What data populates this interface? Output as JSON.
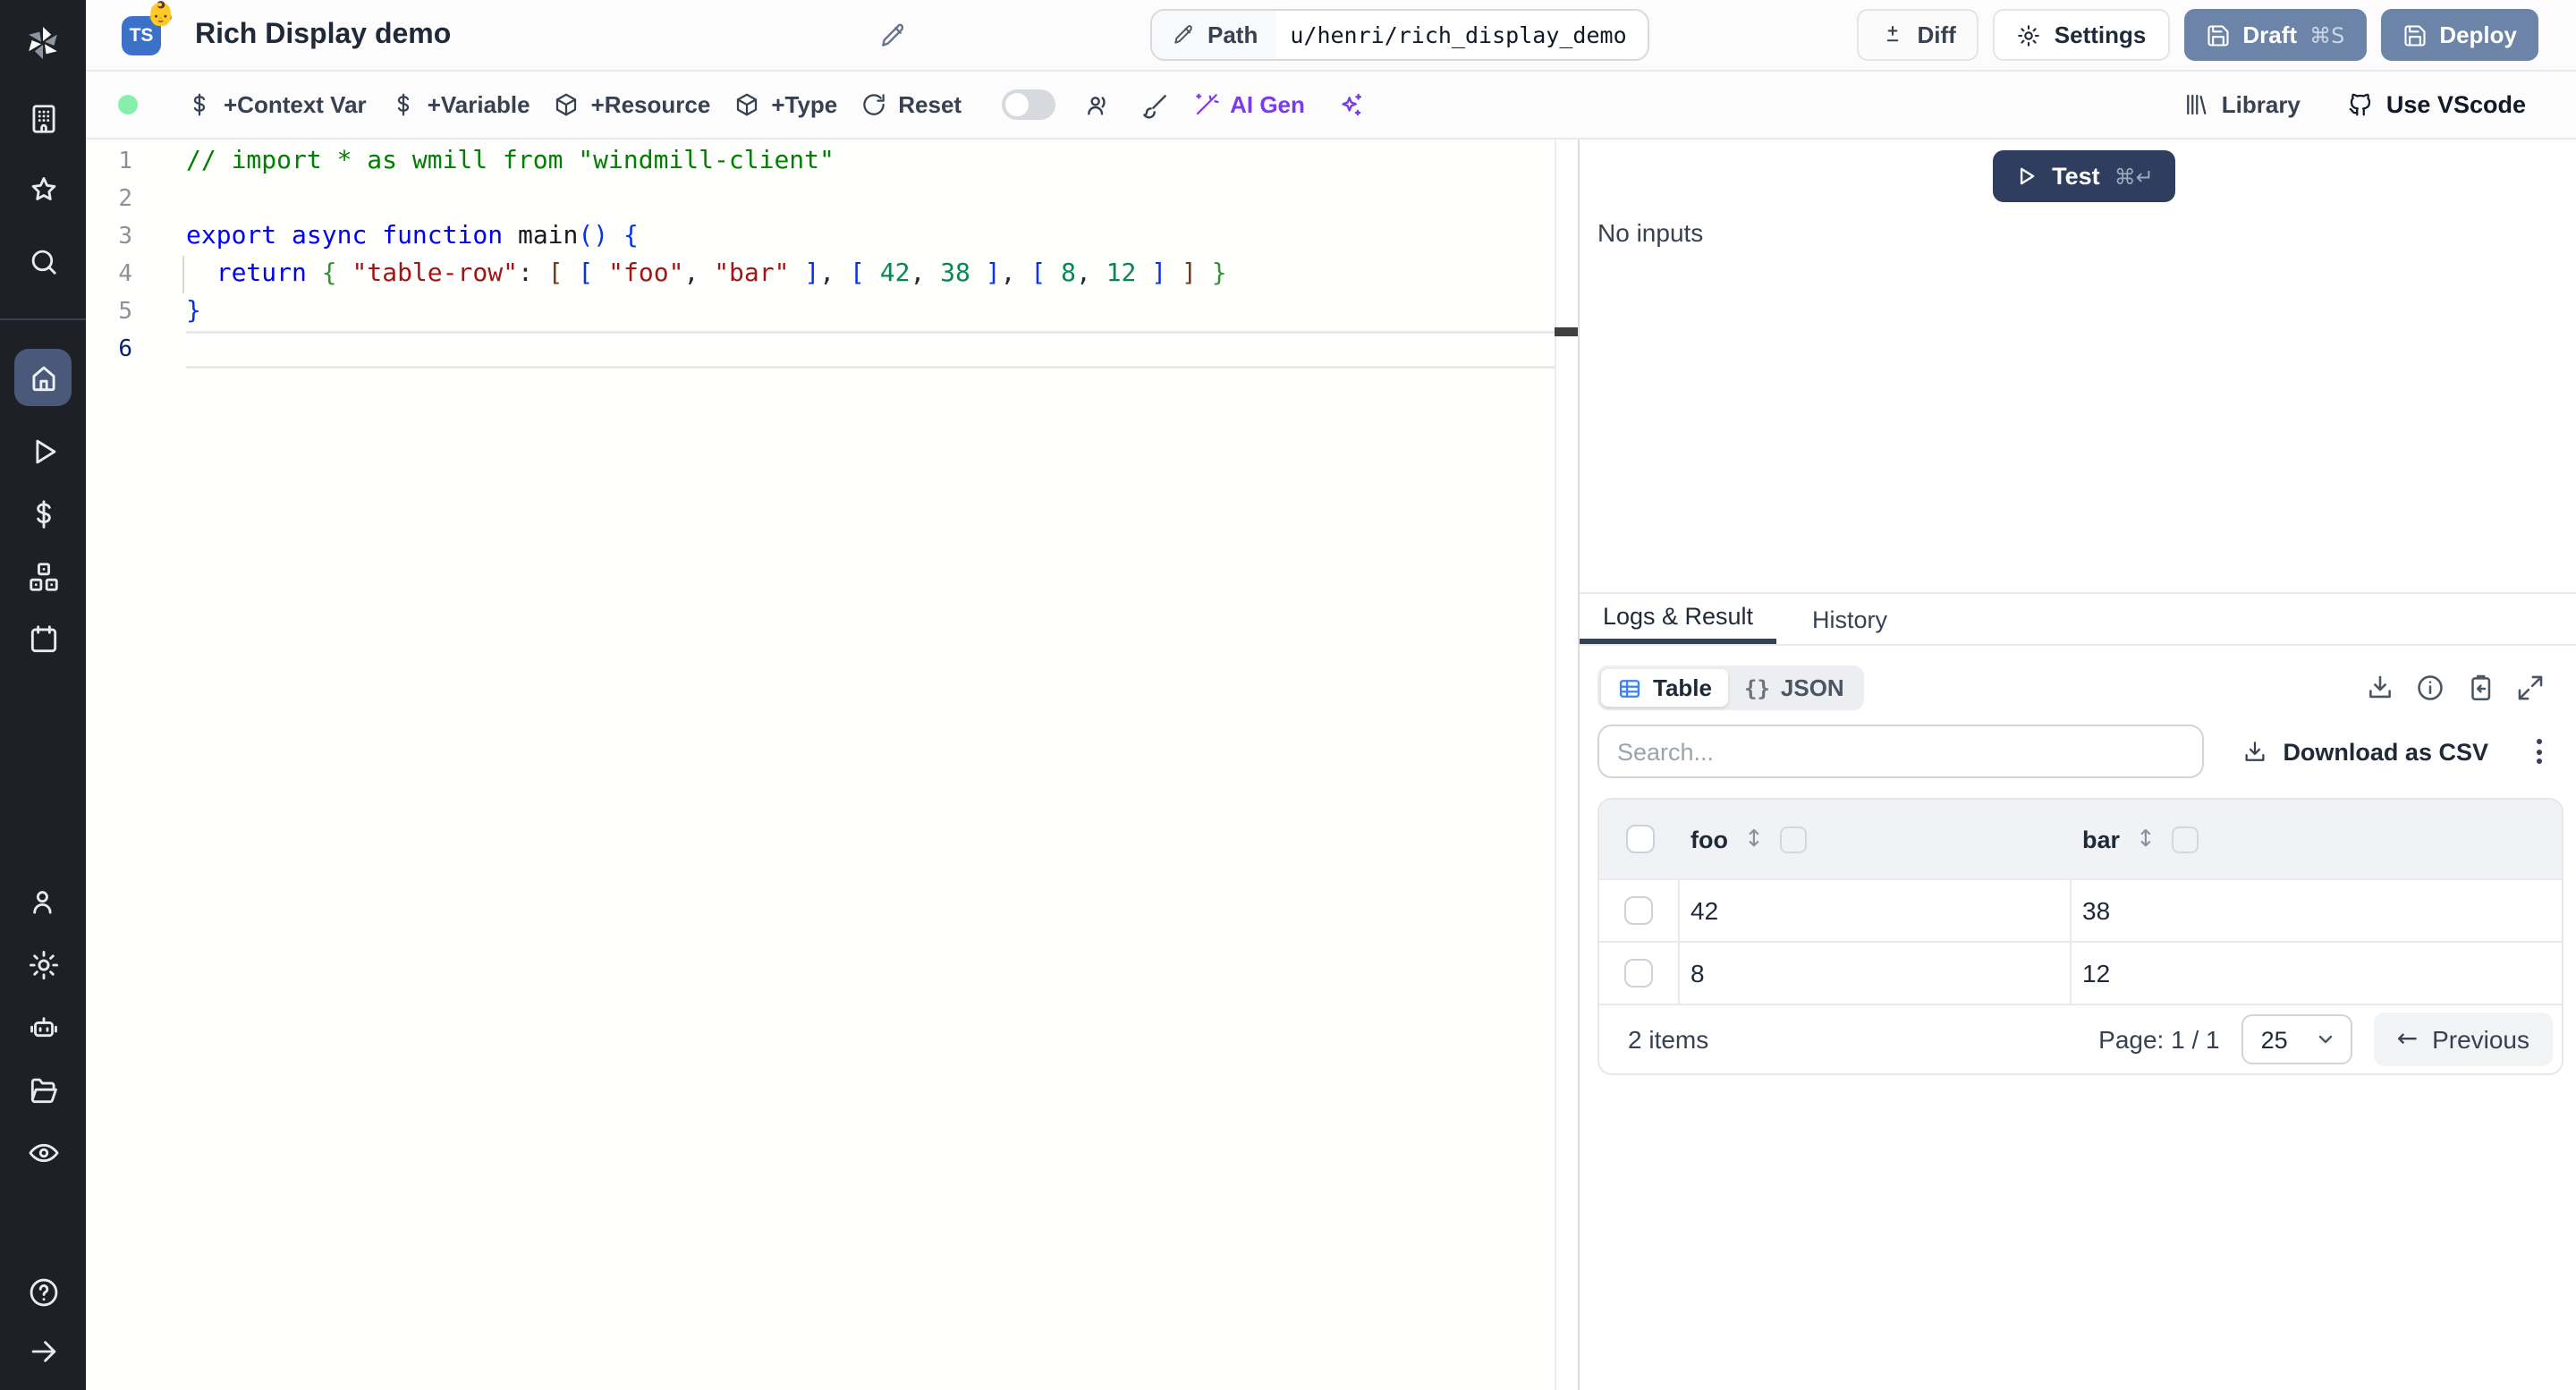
{
  "colors": {
    "accent_blue": "#3b82f6",
    "button_slate": "#6b84a8",
    "test_navy": "#2f3e5e",
    "ai_purple": "#7c3aed",
    "status_green": "#86efac",
    "sidebar_bg": "#1d2027"
  },
  "header": {
    "title": "Rich Display demo",
    "lang_badge": "TS",
    "emoji": "👶",
    "path_label": "Path",
    "path_value": "u/henri/rich_display_demo",
    "diff_label": "Diff",
    "settings_label": "Settings",
    "draft_label": "Draft",
    "draft_shortcut": "⌘S",
    "deploy_label": "Deploy"
  },
  "toolbar": {
    "context_var": "+Context Var",
    "variable": "+Variable",
    "resource": "+Resource",
    "type": "+Type",
    "reset": "Reset",
    "ai_gen": "AI Gen",
    "library": "Library",
    "vscode": "Use VScode"
  },
  "editor": {
    "lines": [
      {
        "n": "1",
        "tokens": [
          [
            "cmt",
            "// import * as wmill from \"windmill-client\""
          ]
        ]
      },
      {
        "n": "2",
        "tokens": []
      },
      {
        "n": "3",
        "tokens": [
          [
            "kw",
            "export"
          ],
          [
            "pl",
            " "
          ],
          [
            "kw",
            "async"
          ],
          [
            "pl",
            " "
          ],
          [
            "kw",
            "function"
          ],
          [
            "pl",
            " "
          ],
          [
            "fn",
            "main"
          ],
          [
            "b1",
            "()"
          ],
          [
            "pl",
            " "
          ],
          [
            "b1",
            "{"
          ]
        ]
      },
      {
        "n": "4",
        "guide": true,
        "tokens": [
          [
            "pl",
            "  "
          ],
          [
            "kw",
            "return"
          ],
          [
            "pl",
            " "
          ],
          [
            "b2",
            "{"
          ],
          [
            "pl",
            " "
          ],
          [
            "str",
            "\"table-row\""
          ],
          [
            "pl",
            ": "
          ],
          [
            "b3",
            "["
          ],
          [
            "pl",
            " "
          ],
          [
            "b1",
            "["
          ],
          [
            "pl",
            " "
          ],
          [
            "str",
            "\"foo\""
          ],
          [
            "pl",
            ", "
          ],
          [
            "str",
            "\"bar\""
          ],
          [
            "pl",
            " "
          ],
          [
            "b1",
            "]"
          ],
          [
            "pl",
            ", "
          ],
          [
            "b1",
            "["
          ],
          [
            "pl",
            " "
          ],
          [
            "num",
            "42"
          ],
          [
            "pl",
            ", "
          ],
          [
            "num",
            "38"
          ],
          [
            "pl",
            " "
          ],
          [
            "b1",
            "]"
          ],
          [
            "pl",
            ", "
          ],
          [
            "b1",
            "["
          ],
          [
            "pl",
            " "
          ],
          [
            "num",
            "8"
          ],
          [
            "pl",
            ", "
          ],
          [
            "num",
            "12"
          ],
          [
            "pl",
            " "
          ],
          [
            "b1",
            "]"
          ],
          [
            "pl",
            " "
          ],
          [
            "b3",
            "]"
          ],
          [
            "pl",
            " "
          ],
          [
            "b2",
            "}"
          ]
        ]
      },
      {
        "n": "5",
        "tokens": [
          [
            "b1",
            "}"
          ]
        ]
      },
      {
        "n": "6",
        "active": true,
        "tokens": []
      }
    ]
  },
  "run_panel": {
    "test_label": "Test",
    "test_shortcut": "⌘↵",
    "no_inputs": "No inputs"
  },
  "results": {
    "tab_logs": "Logs & Result",
    "tab_history": "History",
    "view_table": "Table",
    "view_json": "JSON",
    "braces": "{}",
    "search_placeholder": "Search...",
    "download_csv": "Download as CSV",
    "table": {
      "columns": [
        "foo",
        "bar"
      ],
      "rows": [
        [
          "42",
          "38"
        ],
        [
          "8",
          "12"
        ]
      ],
      "sort_glyph": "↕",
      "items_text": "2 items",
      "page_text": "Page: 1 / 1",
      "page_size": "25",
      "prev_arrow": "←",
      "prev_label": "Previous"
    }
  }
}
